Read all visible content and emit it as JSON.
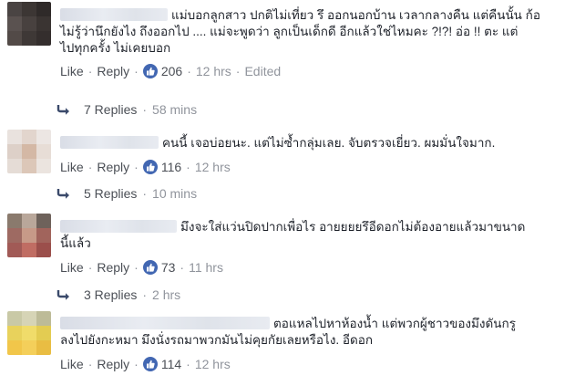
{
  "colors": {
    "link": "#4b4f56",
    "muted": "#90949c",
    "like_blue": "#4267b2",
    "text": "#1d2129"
  },
  "comments": [
    {
      "lines": [
        "แม่บอกลูกสาว ปกติไม่เที่ยว รึ ออกนอกบ้าน เวลากลางคืน แต่คืนนั้น ก้อ",
        "ไม่รู้ว่านึกยังไง ถึงออกไป .... แม่จะพูดว่า ลูกเป็นเด็กดี อีกแล้วใช่ไหมคะ ?!?! อ่อ !! ตะ แต่",
        "ไปทุกครั้ง ไม่เคยบอก"
      ],
      "like_label": "Like",
      "reply_label": "Reply",
      "likes": "206",
      "time": "12 hrs",
      "edited": "Edited",
      "replies_label": "7 Replies",
      "replies_time": "58 mins"
    },
    {
      "lines": [
        "คนนี้ เจอบ่อยนะ. แต่ไม่ซ้ำกลุ่มเลย. จับตรวจเยี่ยว. ผมมั่นใจมาก."
      ],
      "like_label": "Like",
      "reply_label": "Reply",
      "likes": "116",
      "time": "12 hrs",
      "replies_label": "5 Replies",
      "replies_time": "10 mins"
    },
    {
      "lines": [
        "มึงจะใส่แว่นปิดปากเพื่อไร อายยยยรึอีดอกไม่ต้องอายแล้วมาขนาด",
        "นี้แล้ว"
      ],
      "like_label": "Like",
      "reply_label": "Reply",
      "likes": "73",
      "time": "11 hrs",
      "replies_label": "3 Replies",
      "replies_time": "2 hrs"
    },
    {
      "lines": [
        "ตอแหลไปหาห้องน้ำ แต่พวกผู้ชาวของมึงดันกรู",
        "ลงไปยังกะหมา มึงนั่งรถมาพวกมันไม่คุยกัยเลยหรือไง. อีดอก"
      ],
      "like_label": "Like",
      "reply_label": "Reply",
      "likes": "114",
      "time": "12 hrs"
    }
  ],
  "separator": "·",
  "icons": {
    "like": "thumbs-up-icon",
    "reply_arrow": "reply-arrow-icon"
  }
}
